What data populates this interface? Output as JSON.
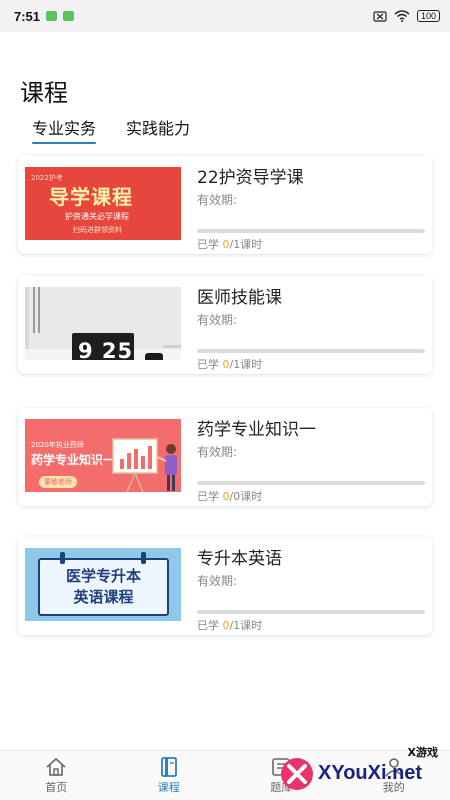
{
  "status_bar": {
    "time": "7:51",
    "battery": "100"
  },
  "page": {
    "title": "课程"
  },
  "tabs": [
    {
      "label": "专业实务",
      "active": true
    },
    {
      "label": "实践能力",
      "active": false
    }
  ],
  "courses": [
    {
      "title": "22护资导学课",
      "valid_label": "有效期:",
      "studied_prefix": "已学 ",
      "studied_done": "0",
      "studied_suffix": "/1课时",
      "progress_fraction": 0,
      "thumb": {
        "year": "2022护考",
        "main": "导学课程",
        "sub": "护资通关必学课程",
        "sub2": "扫码进群领资料"
      }
    },
    {
      "title": "医师技能课",
      "valid_label": "有效期:",
      "studied_prefix": "已学 ",
      "studied_done": "0",
      "studied_suffix": "/1课时",
      "progress_fraction": 0,
      "thumb": {
        "clock": "9 25"
      }
    },
    {
      "title": "药学专业知识一",
      "valid_label": "有效期:",
      "studied_prefix": "已学 ",
      "studied_done": "0",
      "studied_suffix": "/0课时",
      "progress_fraction": 0,
      "thumb": {
        "year": "2020年执业药师",
        "main": "药学专业知识一",
        "badge": "董敏老师"
      }
    },
    {
      "title": "专升本英语",
      "valid_label": "有效期:",
      "studied_prefix": "已学 ",
      "studied_done": "0",
      "studied_suffix": "/1课时",
      "progress_fraction": 0,
      "thumb": {
        "line1": "医学专升本",
        "line2": "英语课程"
      }
    }
  ],
  "bottom_nav": [
    {
      "label": "首页",
      "icon": "home-icon",
      "active": false
    },
    {
      "label": "课程",
      "icon": "course-book-icon",
      "active": true
    },
    {
      "label": "题库",
      "icon": "question-bank-icon",
      "active": false
    },
    {
      "label": "我的",
      "icon": "profile-icon",
      "active": false
    }
  ],
  "watermark": {
    "small": "X游戏",
    "big": "XYouXi.net"
  },
  "colors": {
    "accent": "#2a7fc5",
    "progress": "#f5a623",
    "card_shadow": "#dce6f2"
  }
}
